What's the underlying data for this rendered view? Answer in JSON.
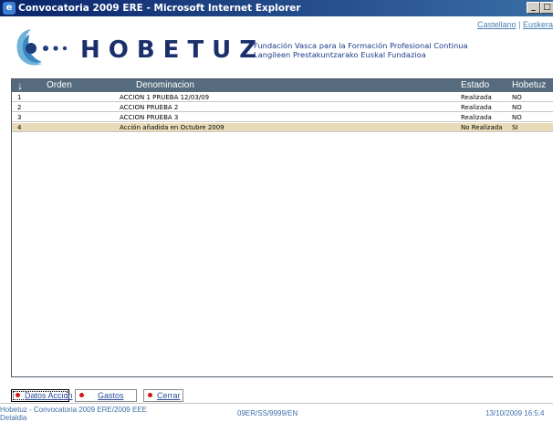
{
  "window": {
    "title": "Convocatoria 2009 ERE - Microsoft Internet Explorer",
    "minimize": "_",
    "maximize": "□",
    "close": "X"
  },
  "header": {
    "lang_castellano": "Castellano",
    "lang_separator": " | ",
    "lang_euskera": "Euskera",
    "brand": "HOBETUZ",
    "subtitle_es": "Fundación Vasca para la Formación Profesional Continua",
    "subtitle_eu": "Langileen Prestakuntzarako Euskal Fundazioa"
  },
  "table": {
    "sort_icon": "↓",
    "columns": {
      "orden": "Orden",
      "denominacion": "Denominacion",
      "estado": "Estado",
      "hobetuz": "Hobetuz"
    },
    "rows": [
      {
        "orden": "1",
        "denominacion": "ACCION 1 PRUEBA 12/03/09",
        "estado": "Realizada",
        "hobetuz": "NO"
      },
      {
        "orden": "2",
        "denominacion": "ACCION PRUEBA 2",
        "estado": "Realizada",
        "hobetuz": "NO"
      },
      {
        "orden": "3",
        "denominacion": "ACCION PRUEBA 3",
        "estado": "Realizada",
        "hobetuz": "NO"
      },
      {
        "orden": "4",
        "denominacion": "Acción añadida en Octubre 2009",
        "estado": "No Realizada",
        "hobetuz": "SI"
      }
    ],
    "selected_row": 4
  },
  "tabs": {
    "datos_accion": "Datos Accion",
    "gastos": "Gastos",
    "cerrar": "Cerrar"
  },
  "status": {
    "line1": "Hobetuz - Convocatoria 2009 ERE/2009 EEE",
    "line2": "Detaldia",
    "code": "09ER/SS/9999/EN",
    "datetime": "13/10/2009 16:5:4"
  },
  "colors": {
    "brand": "#1a2f6b",
    "header_bar": "#566c7e",
    "selected_row": "#e8dcb8",
    "link": "#3b6fa8"
  }
}
